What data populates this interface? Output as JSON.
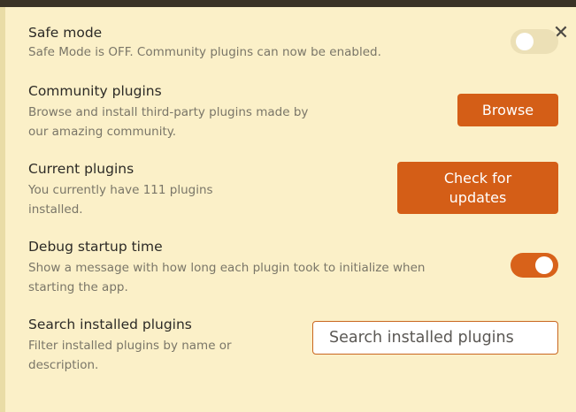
{
  "close_glyph": "✕",
  "settings": {
    "safe_mode": {
      "title": "Safe mode",
      "desc": "Safe Mode is OFF. Community plugins can now be enabled.",
      "toggle_on": false
    },
    "community": {
      "title": "Community plugins",
      "desc_line1": "Browse and install third-party plugins made by",
      "desc_line2": "our amazing community.",
      "button": "Browse"
    },
    "current": {
      "title": "Current plugins",
      "desc_line1": "You currently have 111 plugins",
      "desc_line2": "installed.",
      "button_line1": "Check for",
      "button_line2": "updates"
    },
    "debug": {
      "title": "Debug startup time",
      "desc_line1": "Show a message with how long each plugin took to initialize when",
      "desc_line2": "starting the app.",
      "toggle_on": true
    },
    "search": {
      "title": "Search installed plugins",
      "desc_line1": "Filter installed plugins by name or",
      "desc_line2": "description.",
      "placeholder": "Search installed plugins"
    }
  },
  "colors": {
    "accent": "#d45e17",
    "background": "#fbf0c8"
  },
  "icons": [
    "close-icon"
  ]
}
